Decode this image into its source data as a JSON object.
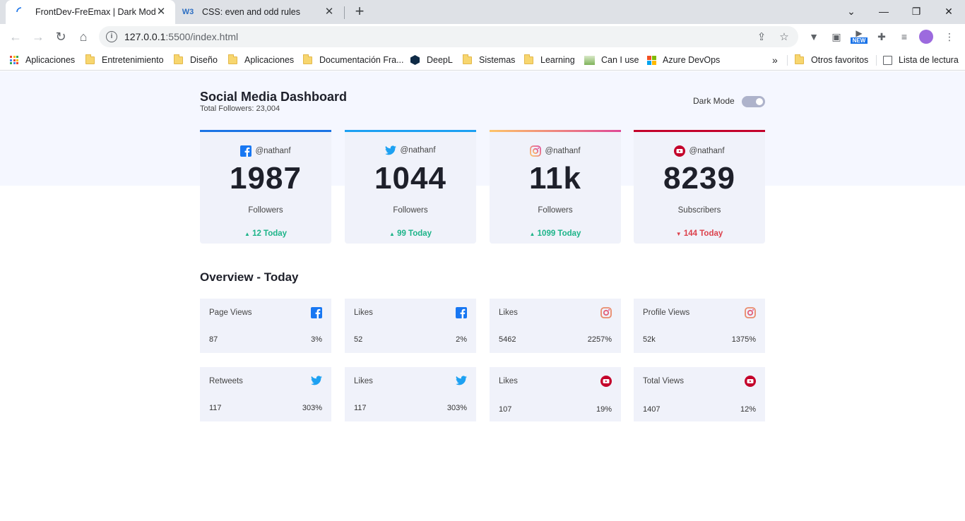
{
  "browser": {
    "tabs": [
      {
        "title": "FrontDev-FreEmax | Dark Mode",
        "favicon": "spinner-icon"
      },
      {
        "title": "CSS: even and odd rules",
        "favicon": "W3"
      }
    ],
    "url_host": "127.0.0.1",
    "url_rest": ":5500/index.html",
    "bookmarks": [
      "Aplicaciones",
      "Entretenimiento",
      "Diseño",
      "Aplicaciones",
      "Documentación Fra...",
      "DeepL",
      "Sistemas",
      "Learning",
      "Can I use",
      "Azure DevOps"
    ],
    "bookmarks_more": "»",
    "other_favorites": "Otros favoritos",
    "reading_list": "Lista de lectura",
    "new_badge": "NEW"
  },
  "dashboard": {
    "title": "Social Media Dashboard",
    "total_followers": "Total Followers: 23,004",
    "dark_mode_label": "Dark Mode",
    "dark_mode_on": false
  },
  "cards": [
    {
      "network": "facebook",
      "handle": "@nathanf",
      "count": "1987",
      "unit": "Followers",
      "change": "12 Today",
      "trend": "up",
      "color": "#1b74e4"
    },
    {
      "network": "twitter",
      "handle": "@nathanf",
      "count": "1044",
      "unit": "Followers",
      "change": "99 Today",
      "trend": "up",
      "color": "#1ca0f2"
    },
    {
      "network": "instagram",
      "handle": "@nathanf",
      "count": "11k",
      "unit": "Followers",
      "change": "1099 Today",
      "trend": "up",
      "color": "#e4405f"
    },
    {
      "network": "youtube",
      "handle": "@nathanf",
      "count": "8239",
      "unit": "Subscribers",
      "change": "144 Today",
      "trend": "down",
      "color": "#c4032b"
    }
  ],
  "overview": {
    "title": "Overview - Today",
    "items": [
      {
        "label": "Page Views",
        "network": "facebook",
        "value": "87",
        "percent": "3%"
      },
      {
        "label": "Likes",
        "network": "facebook",
        "value": "52",
        "percent": "2%"
      },
      {
        "label": "Likes",
        "network": "instagram",
        "value": "5462",
        "percent": "2257%"
      },
      {
        "label": "Profile Views",
        "network": "instagram",
        "value": "52k",
        "percent": "1375%"
      },
      {
        "label": "Retweets",
        "network": "twitter",
        "value": "117",
        "percent": "303%"
      },
      {
        "label": "Likes",
        "network": "twitter",
        "value": "117",
        "percent": "303%"
      },
      {
        "label": "Likes",
        "network": "youtube",
        "value": "107",
        "percent": "19%"
      },
      {
        "label": "Total Views",
        "network": "youtube",
        "value": "1407",
        "percent": "12%"
      }
    ]
  }
}
